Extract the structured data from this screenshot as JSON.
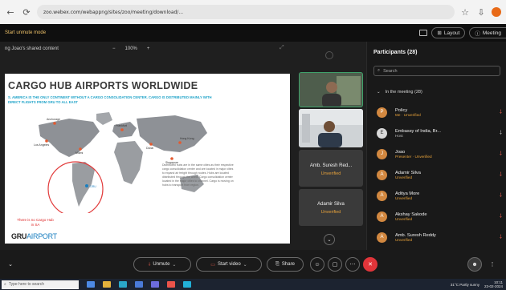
{
  "browser": {
    "url": "zoo.webex.com/webappng/sites/zoo/meeting/download/...",
    "back_icon": "arrow-left-icon",
    "reload_icon": "reload-icon"
  },
  "meeting": {
    "title": "Start unmute mode",
    "layout_label": "Layout",
    "meeting_label": "Meeting"
  },
  "share": {
    "label": "ng Joao's shared content",
    "zoom": "100%",
    "zoom_minus": "−",
    "zoom_plus": "+"
  },
  "slide": {
    "title": "CARGO HUB AIRPORTS WORLDWIDE",
    "subtitle": "S. AMERICA IS THE ONLY CONTINENT WITHOUT A CARGO CONSOLIDATION CENTER. CARGO IS DISTRIBUTED MAINLY WITH DIRECT FLIGHTS FROM GRU TO ALL EAST",
    "note": "There is no Cargo Hub in SA",
    "logo_a": "GRU",
    "logo_b": "AIRPORT",
    "city_labels": [
      "Anchorage",
      "Frankfurt",
      "Los Angeles",
      "Miami",
      "Dubai",
      "Hong Kong",
      "Singapore",
      "GRU"
    ],
    "legend_lines": [
      "Distributed hubs are in the same cities as their respective",
      "cargo consolidation center and are located in major cities",
      "to expand air freight through routes. Hubs are located",
      "distributed through the world. Cargo consolidation center",
      "located in the major cities to channel. Cargo is moving on",
      "hubs to transport from region."
    ]
  },
  "tiles": [
    {
      "name": "",
      "status": ""
    },
    {
      "name": "",
      "status": ""
    },
    {
      "name": "Amb. Suresh Red...",
      "status": "Unverified"
    },
    {
      "name": "Adamir Silva",
      "status": "Unverified"
    }
  ],
  "participants": {
    "title": "Participants (28)",
    "search_placeholder": "Search",
    "section_label": "In the meeting (28)",
    "list": [
      {
        "name": "Policy",
        "status": "Me · Unverified",
        "initial": "P"
      },
      {
        "name": "Embassy of India, Br...",
        "status": "Host",
        "initial": "E"
      },
      {
        "name": "Joao",
        "status": "Presenter · Unverified",
        "initial": "J"
      },
      {
        "name": "Adamir Silva",
        "status": "Unverified",
        "initial": "A"
      },
      {
        "name": "Aditya More",
        "status": "Unverified",
        "initial": "A"
      },
      {
        "name": "Akshay Sakode",
        "status": "Unverified",
        "initial": "A"
      },
      {
        "name": "Amb. Suresh Reddy",
        "status": "Unverified",
        "initial": "A"
      }
    ]
  },
  "toolbar": {
    "unmute": "Unmute",
    "start_video": "Start video",
    "share": "Share"
  },
  "taskbar": {
    "search_placeholder": "Type here to search",
    "weather": "31°C Partly sunny",
    "time": "10:11",
    "date": "23-02-2024"
  },
  "colors": {
    "accent_warning": "#e8a23a",
    "end_call": "#e0353a",
    "title_text": "#3a3a3a",
    "subtitle_text": "#1fa3c8"
  }
}
